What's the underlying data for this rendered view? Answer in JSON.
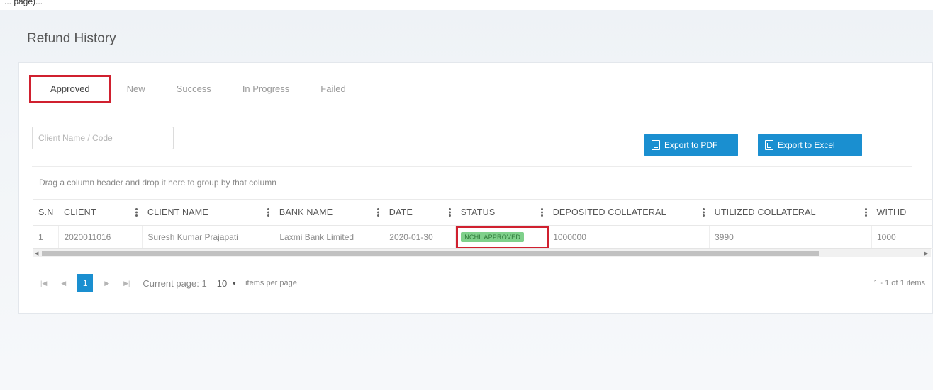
{
  "top_strip_text": "... page)...",
  "page_title": "Refund History",
  "tabs": [
    {
      "label": "Approved",
      "active": true
    },
    {
      "label": "New",
      "active": false
    },
    {
      "label": "Success",
      "active": false
    },
    {
      "label": "In Progress",
      "active": false
    },
    {
      "label": "Failed",
      "active": false
    }
  ],
  "search": {
    "placeholder": "Client Name / Code",
    "value": ""
  },
  "export_pdf_label": "Export to PDF",
  "export_excel_label": "Export to Excel",
  "group_hint": "Drag a column header and drop it here to group by that column",
  "columns": [
    "S.N",
    "CLIENT",
    "CLIENT NAME",
    "BANK NAME",
    "DATE",
    "STATUS",
    "DEPOSITED COLLATERAL",
    "UTILIZED COLLATERAL",
    "WITHD"
  ],
  "rows": [
    {
      "sn": "1",
      "client": "2020011016",
      "client_name": "Suresh Kumar Prajapati",
      "bank_name": "Laxmi Bank Limited",
      "date": "2020-01-30",
      "status": "NCHL APPROVED",
      "deposited_collateral": "1000000",
      "utilized_collateral": "3990",
      "withd": "1000"
    }
  ],
  "pager": {
    "current_page": "1",
    "current_page_text": "Current page: 1",
    "page_size": "10",
    "per_page_text": "items per page",
    "summary": "1 - 1 of 1 items"
  },
  "colors": {
    "accent": "#1a8fd0",
    "highlight": "#d0202f",
    "status_bg": "#7fd08b"
  }
}
